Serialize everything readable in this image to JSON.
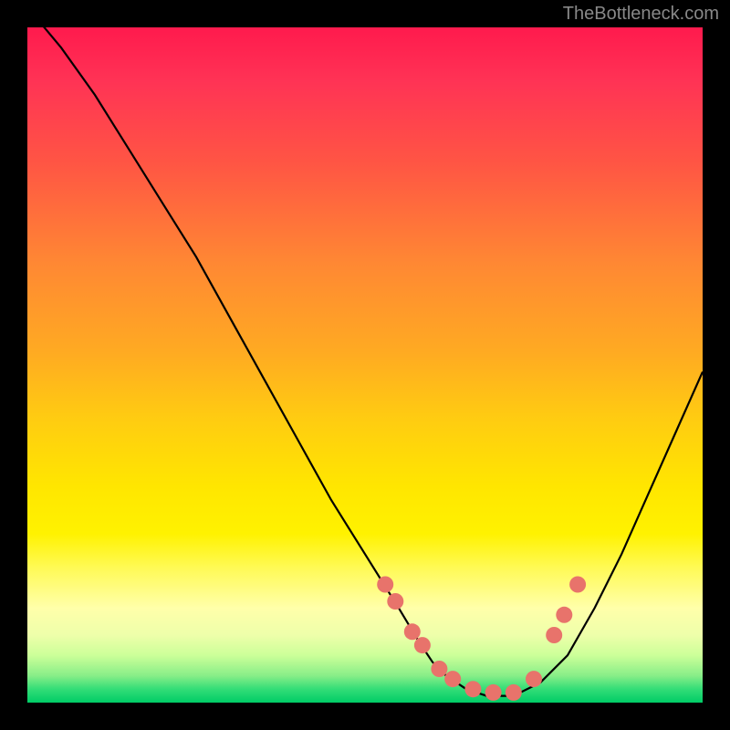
{
  "watermark": "TheBottleneck.com",
  "chart_data": {
    "type": "line",
    "title": "",
    "xlabel": "",
    "ylabel": "",
    "xlim": [
      0,
      100
    ],
    "ylim": [
      0,
      100
    ],
    "curve": {
      "x": [
        0,
        5,
        10,
        15,
        20,
        25,
        30,
        35,
        40,
        45,
        50,
        55,
        58,
        60,
        62,
        65,
        68,
        72,
        76,
        80,
        84,
        88,
        92,
        96,
        100
      ],
      "y": [
        103,
        97,
        90,
        82,
        74,
        66,
        57,
        48,
        39,
        30,
        22,
        14,
        9,
        6,
        4,
        2,
        1,
        1,
        3,
        7,
        14,
        22,
        31,
        40,
        49
      ]
    },
    "series": [
      {
        "name": "data-points",
        "x": [
          53,
          54.5,
          57,
          58.5,
          61,
          63,
          66,
          69,
          72,
          75,
          78,
          79.5,
          81.5
        ],
        "y": [
          17.5,
          15,
          10.5,
          8.5,
          5,
          3.5,
          2,
          1.5,
          1.5,
          3.5,
          10,
          13,
          17.5
        ]
      }
    ]
  }
}
